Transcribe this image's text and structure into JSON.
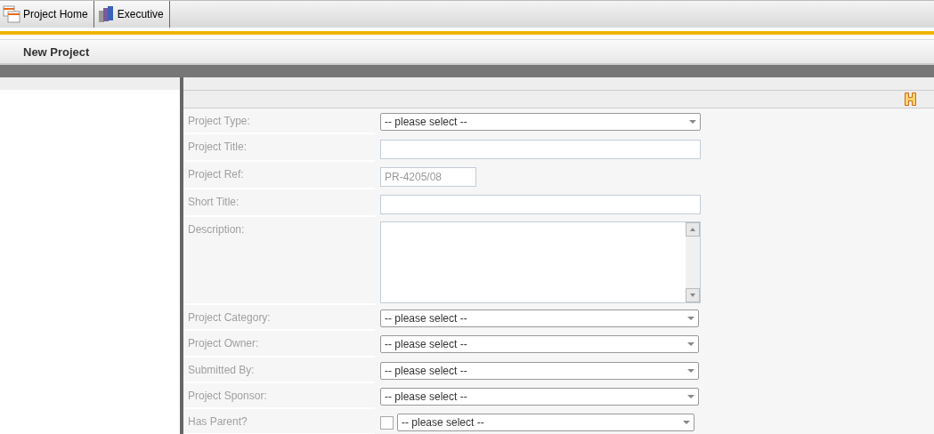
{
  "tabs": [
    {
      "label": "Project Home"
    },
    {
      "label": "Executive"
    }
  ],
  "page_title": "New Project",
  "form": [
    {
      "kind": "select",
      "label": "Project Type:",
      "value": "-- please select --"
    },
    {
      "kind": "text",
      "label": "Project Title:"
    },
    {
      "kind": "ref",
      "label": "Project Ref:",
      "value": "PR-4205/08"
    },
    {
      "kind": "text",
      "label": "Short Title:"
    },
    {
      "kind": "textarea",
      "label": "Description:"
    },
    {
      "kind": "select",
      "label": "Project Category:",
      "value": "-- please select --"
    },
    {
      "kind": "select",
      "label": "Project Owner:",
      "value": "-- please select --"
    },
    {
      "kind": "select",
      "label": "Submitted By:",
      "value": "-- please select --"
    },
    {
      "kind": "select",
      "label": "Project Sponsor:",
      "value": "-- please select --"
    },
    {
      "kind": "checkselect",
      "label": "Has Parent?",
      "checked": false,
      "value": "-- please select --"
    }
  ]
}
